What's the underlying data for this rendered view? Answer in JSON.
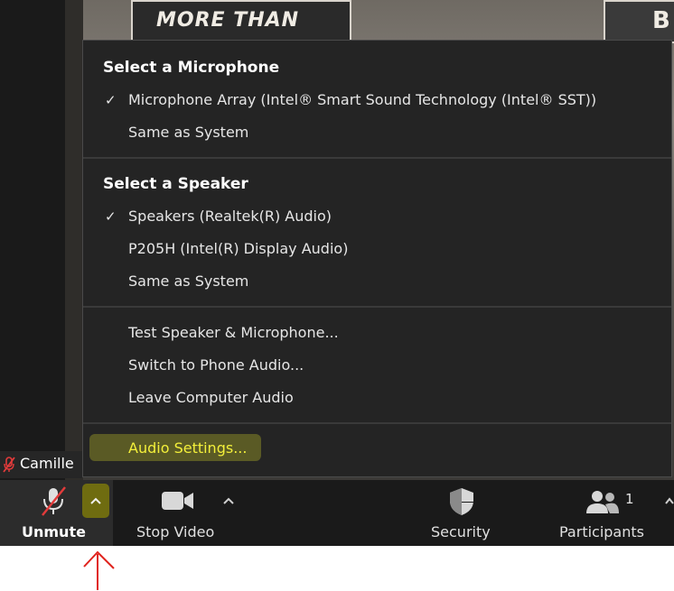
{
  "background": {
    "sign_left_text": "MORE THAN",
    "sign_right_text": "B"
  },
  "menu": {
    "microphone_title": "Select a Microphone",
    "microphone_items": [
      {
        "label": "Microphone Array (Intel® Smart Sound Technology (Intel® SST))",
        "selected": true
      },
      {
        "label": "Same as System",
        "selected": false
      }
    ],
    "speaker_title": "Select a Speaker",
    "speaker_items": [
      {
        "label": "Speakers (Realtek(R) Audio)",
        "selected": true
      },
      {
        "label": "P205H (Intel(R) Display Audio)",
        "selected": false
      },
      {
        "label": "Same as System",
        "selected": false
      }
    ],
    "actions": [
      {
        "label": "Test Speaker & Microphone..."
      },
      {
        "label": "Switch to Phone Audio..."
      },
      {
        "label": "Leave Computer Audio"
      }
    ],
    "audio_settings_label": "Audio Settings...",
    "check_glyph": "✓",
    "highlight_color": "#f3ef3a"
  },
  "name_tag": {
    "name": "Camille"
  },
  "toolbar": {
    "unmute_label": "Unmute",
    "stop_video_label": "Stop Video",
    "security_label": "Security",
    "participants_label": "Participants",
    "participants_count": "1",
    "caret_glyph": "^"
  },
  "colors": {
    "menu_bg": "#242424",
    "toolbar_bg": "#1a1a1a",
    "annotation_red": "#e0221c"
  }
}
